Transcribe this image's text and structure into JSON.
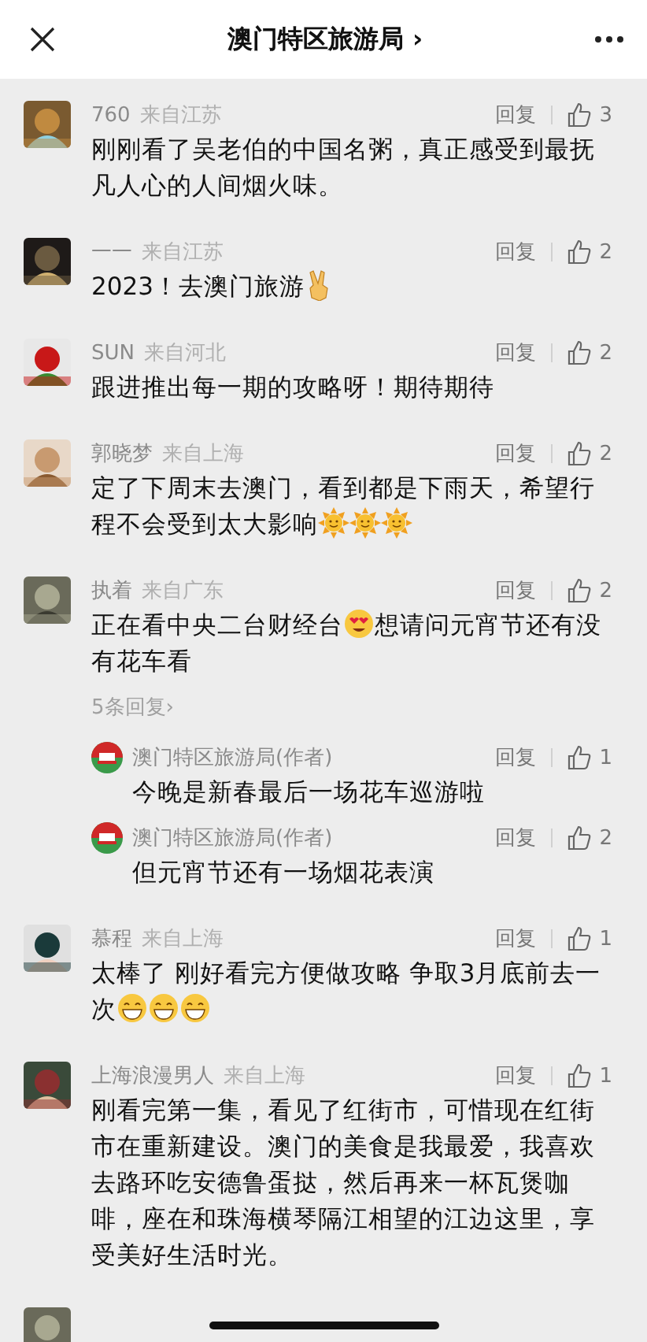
{
  "header": {
    "title": "澳门特区旅游局",
    "chevron": "›"
  },
  "comments": [
    {
      "name": "760",
      "location": "来自江苏",
      "reply": "回复",
      "likes": "3",
      "content": [
        {
          "kind": "text",
          "text": "刚刚看了吴老伯的中国名粥，真正感受到最抚凡人心的人间烟火味。"
        }
      ]
    },
    {
      "name": "一一",
      "location": "来自江苏",
      "reply": "回复",
      "likes": "2",
      "content": [
        {
          "kind": "text",
          "text": "2023！去澳门旅游"
        },
        {
          "kind": "victory"
        }
      ]
    },
    {
      "name": "SUN",
      "location": "来自河北",
      "reply": "回复",
      "likes": "2",
      "content": [
        {
          "kind": "text",
          "text": "跟进推出每一期的攻略呀！期待期待"
        }
      ]
    },
    {
      "name": "郭晓梦",
      "location": "来自上海",
      "reply": "回复",
      "likes": "2",
      "content": [
        {
          "kind": "text",
          "text": "定了下周末去澳门，看到都是下雨天，希望行"
        },
        {
          "kind": "text",
          "text": "程不会受到太大影响"
        },
        {
          "kind": "sun"
        },
        {
          "kind": "sun"
        },
        {
          "kind": "sun"
        }
      ]
    },
    {
      "name": "执着",
      "location": "来自广东",
      "reply": "回复",
      "likes": "2",
      "content": [
        {
          "kind": "text",
          "text": "正在看中央二台财经台"
        },
        {
          "kind": "hearteyes"
        },
        {
          "kind": "text",
          "text": "想请问元宵节还有没"
        },
        {
          "kind": "text",
          "text": "有花车看"
        }
      ],
      "more_replies": "5条回复›",
      "replies": [
        {
          "name": "澳门特区旅游局(作者)",
          "reply": "回复",
          "likes": "1",
          "text": "今晚是新春最后一场花车巡游啦"
        },
        {
          "name": "澳门特区旅游局(作者)",
          "reply": "回复",
          "likes": "2",
          "text": "但元宵节还有一场烟花表演"
        }
      ]
    },
    {
      "name": "慕程",
      "location": "来自上海",
      "reply": "回复",
      "likes": "1",
      "content": [
        {
          "kind": "text",
          "text": "太棒了 刚好看完方便做攻略 争取3月底前去一"
        },
        {
          "kind": "text",
          "text": "次"
        },
        {
          "kind": "grin"
        },
        {
          "kind": "grin"
        },
        {
          "kind": "grin"
        }
      ]
    },
    {
      "name": "上海浪漫男人",
      "location": "来自上海",
      "reply": "回复",
      "likes": "1",
      "content": [
        {
          "kind": "text",
          "text": "刚看完第一集，看见了红街市，可惜现在红街市在重新建设。澳门的美食是我最爱，我喜欢去路环吃安德鲁蛋挞，然后再来一杯瓦煲咖啡，座在和珠海横琴隔江相望的江边这里，享受美好生活时光。"
        }
      ]
    }
  ]
}
